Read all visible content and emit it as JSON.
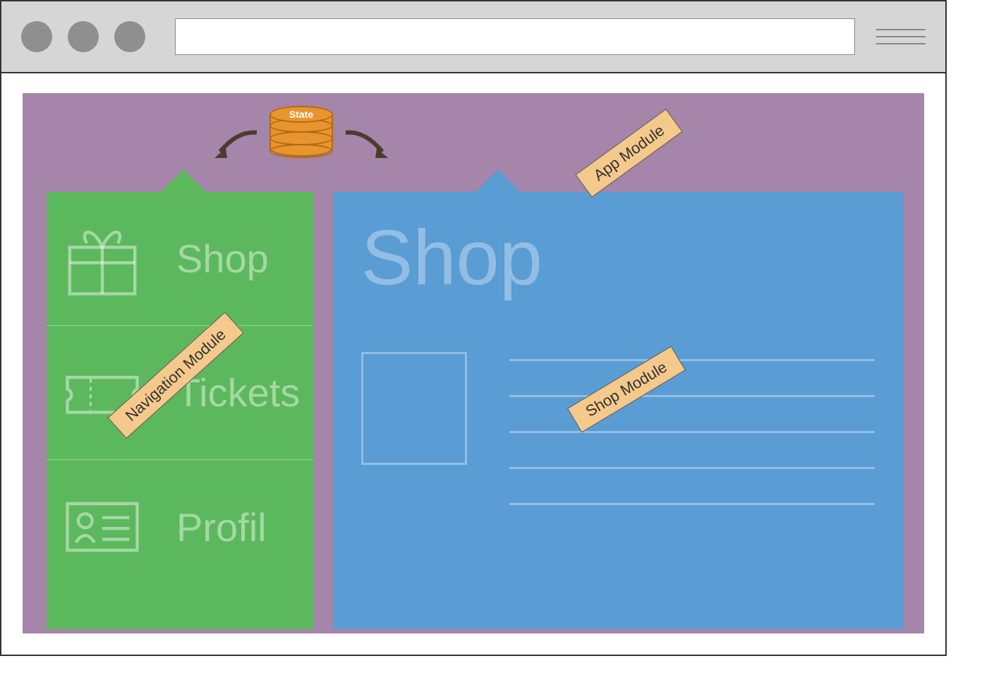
{
  "state_label": "State",
  "nav_items": [
    {
      "label": "Shop"
    },
    {
      "label": "Tickets"
    },
    {
      "label": "Profil"
    }
  ],
  "shop": {
    "title": "Shop"
  },
  "tags": {
    "app": "App Module",
    "nav": "Navigation Module",
    "shop": "Shop Module"
  }
}
